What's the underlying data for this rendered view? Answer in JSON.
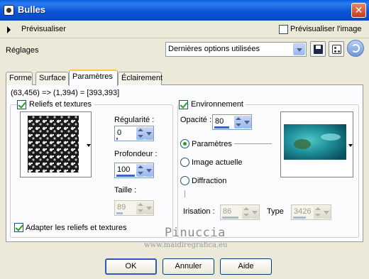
{
  "window": {
    "title": "Bulles",
    "close_symbol": "✕"
  },
  "preview": {
    "label": "Prévisualiser",
    "image_label": "Prévisualiser l'image",
    "image_checked": false
  },
  "settings": {
    "label": "Réglages",
    "preset_value": "Dernières options utilisées",
    "save_icon": "floppy-disk-icon",
    "random_icon": "dice-icon",
    "reset_icon": "reset-icon"
  },
  "tabs": [
    "Forme",
    "Surface",
    "Paramètres",
    "Éclairement"
  ],
  "active_tab": "Paramètres",
  "coords_text": "(63,456) => (1,394) = [393,393]",
  "reliefs": {
    "legend": "Reliefs et textures",
    "checked": true,
    "regularite": {
      "label": "Régularité :",
      "value": "0"
    },
    "profondeur": {
      "label": "Profondeur :",
      "value": "100"
    },
    "taille": {
      "label": "Taille :",
      "value": "89"
    },
    "adapt_label": "Adapter les reliefs et textures",
    "adapt_checked": true
  },
  "environment": {
    "legend": "Environnement",
    "checked": true,
    "opacite": {
      "label": "Opacité :",
      "value": "80"
    },
    "radios": [
      "Paramètres",
      "Image actuelle",
      "Diffraction"
    ],
    "selected_radio": "Paramètres",
    "irisation": {
      "label": "Irisation :",
      "value": "86"
    },
    "type": {
      "label": "Type",
      "value": "3426"
    }
  },
  "watermark": {
    "name": "Pinuccia",
    "url": "www.maidiregrafica.eu"
  },
  "buttons": {
    "ok": "OK",
    "cancel": "Annuler",
    "help": "Aide"
  },
  "colors": {
    "titlebar": "#0a56d8",
    "accent": "#3c64c4",
    "check": "#21a121",
    "tab_highlight": "#ffc83c"
  }
}
